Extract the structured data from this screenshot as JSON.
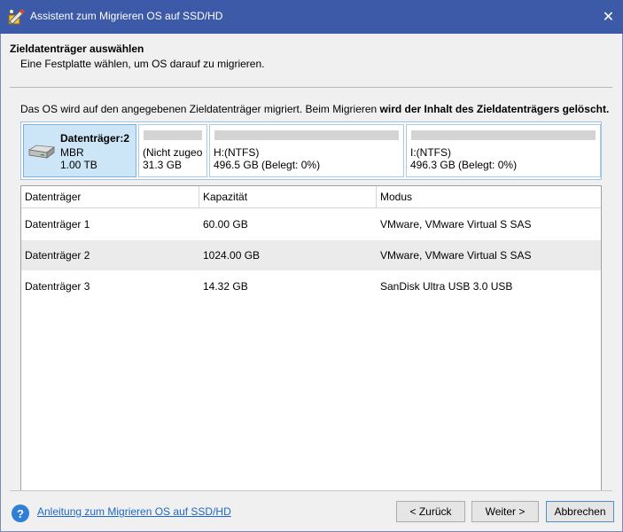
{
  "window": {
    "title": "Assistent zum Migrieren OS auf SSD/HD",
    "close_glyph": "✕"
  },
  "header": {
    "title": "Zieldatenträger auswählen",
    "subtitle": "Eine Festplatte wählen, um OS darauf zu migrieren."
  },
  "info": {
    "text_normal": "Das OS wird auf den angegebenen Zieldatenträger migriert. Beim Migrieren ",
    "text_bold": "wird der Inhalt des Zieldatenträgers gelöscht."
  },
  "disk_map": {
    "name": "Datenträger:2",
    "type": "MBR",
    "size": "1.00 TB",
    "partitions": [
      {
        "name": "(Nicht zugeo",
        "detail": "31.3 GB"
      },
      {
        "name": "H:(NTFS)",
        "detail": "496.5 GB (Belegt: 0%)"
      },
      {
        "name": "I:(NTFS)",
        "detail": "496.3 GB (Belegt: 0%)"
      }
    ]
  },
  "table": {
    "columns": [
      "Datenträger",
      "Kapazität",
      "Modus"
    ],
    "rows": [
      {
        "disk": "Datenträger 1",
        "capacity": "60.00 GB",
        "mode": "VMware, VMware Virtual S SAS"
      },
      {
        "disk": "Datenträger 2",
        "capacity": "1024.00 GB",
        "mode": "VMware, VMware Virtual S SAS"
      },
      {
        "disk": "Datenträger 3",
        "capacity": "14.32 GB",
        "mode": "SanDisk Ultra USB 3.0 USB"
      }
    ]
  },
  "footer": {
    "help_icon_glyph": "?",
    "help_link": "Anleitung zum Migrieren OS auf SSD/HD",
    "back_label": "< Zurück",
    "next_label": "Weiter >",
    "cancel_label": "Abbrechen"
  },
  "colors": {
    "titlebar": "#3d5aa8",
    "selected_disk": "#cde6f7",
    "link": "#1c67c7"
  }
}
